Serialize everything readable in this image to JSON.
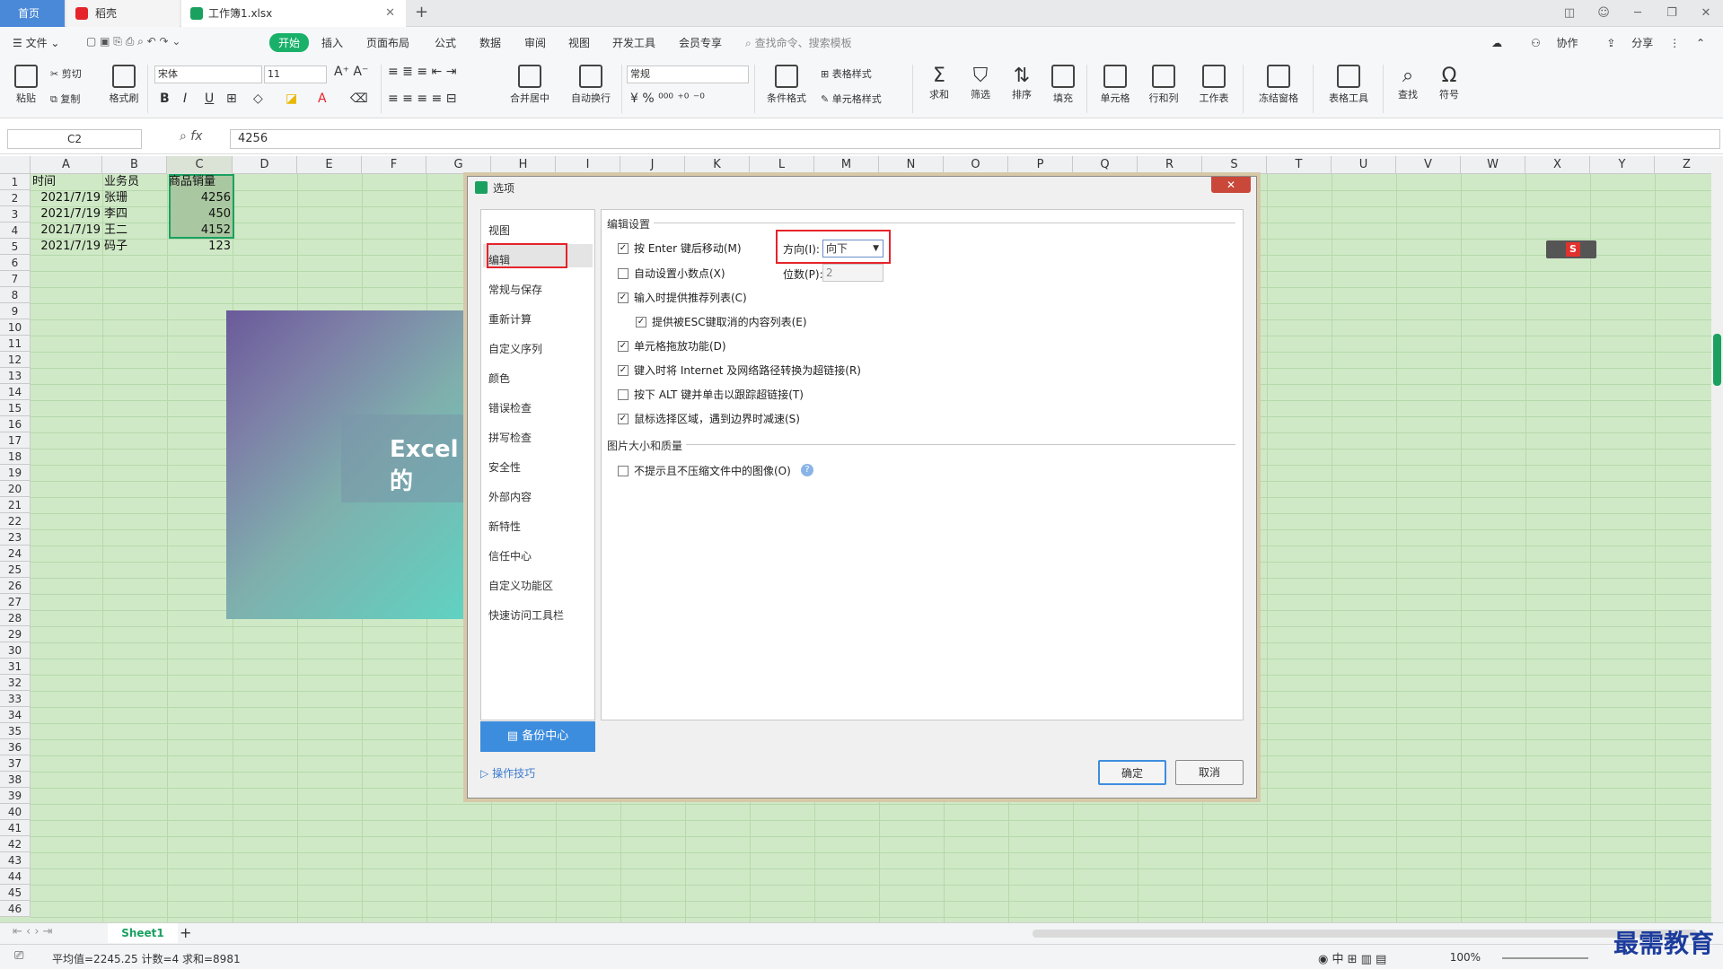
{
  "tabs": {
    "home": "首页",
    "docer": "稻壳",
    "workbook": "工作簿1.xlsx"
  },
  "menu": {
    "file": "文件",
    "start": "开始",
    "insert": "插入",
    "layout": "页面布局",
    "formula": "公式",
    "data": "数据",
    "review": "审阅",
    "view": "视图",
    "dev": "开发工具",
    "member": "会员专享",
    "search": "查找命令、搜索模板",
    "collab": "协作",
    "share": "分享"
  },
  "ribbon": {
    "paste": "粘贴",
    "cut": "剪切",
    "copy": "复制",
    "format_painter": "格式刷",
    "font": "宋体",
    "size": "11",
    "merge": "合并居中",
    "wrap": "自动换行",
    "num_format": "常规",
    "cond_format": "条件格式",
    "table_style": "表格样式",
    "cell_style": "单元格样式",
    "sum": "求和",
    "filter": "筛选",
    "sort": "排序",
    "fill": "填充",
    "cell": "单元格",
    "rowcol": "行和列",
    "sheet": "工作表",
    "freeze": "冻结窗格",
    "table_tools": "表格工具",
    "find": "查找",
    "symbol": "符号"
  },
  "formula": {
    "cell_ref": "C2",
    "fx": "fx",
    "value": "4256"
  },
  "columns": [
    "A",
    "B",
    "C",
    "D",
    "E",
    "F",
    "G",
    "H",
    "I",
    "J",
    "K",
    "L",
    "M",
    "N",
    "O",
    "P",
    "Q",
    "R",
    "S",
    "T",
    "U",
    "V",
    "W",
    "X",
    "Y",
    "Z"
  ],
  "rows": [
    "1",
    "2",
    "3",
    "4",
    "5",
    "6",
    "7",
    "8",
    "9",
    "10",
    "11",
    "12",
    "13",
    "14",
    "15",
    "16",
    "17",
    "18",
    "19",
    "20",
    "21",
    "22",
    "23",
    "24",
    "25",
    "26",
    "27",
    "28",
    "29",
    "30",
    "31",
    "32",
    "33",
    "34",
    "35",
    "36",
    "37",
    "38",
    "39",
    "40",
    "41",
    "42",
    "43",
    "44",
    "45",
    "46"
  ],
  "cells": {
    "header": [
      "时间",
      "业务员",
      "商品销量"
    ],
    "data": [
      [
        "2021/7/19",
        "张珊",
        "4256"
      ],
      [
        "2021/7/19",
        "李四",
        "450"
      ],
      [
        "2021/7/19",
        "王二",
        "4152"
      ],
      [
        "2021/7/19",
        "码子",
        "123"
      ]
    ]
  },
  "promo": {
    "text": "Excel的"
  },
  "dialog": {
    "title": "选项",
    "close": "✕",
    "nav": [
      "视图",
      "编辑",
      "常规与保存",
      "重新计算",
      "自定义序列",
      "颜色",
      "错误检查",
      "拼写检查",
      "安全性",
      "外部内容",
      "新特性",
      "信任中心",
      "自定义功能区",
      "快速访问工具栏"
    ],
    "backup": "备份中心",
    "tips": "操作技巧",
    "section_edit": "编辑设置",
    "opt_enter": "按 Enter 键后移动(M)",
    "direction_label": "方向(I):",
    "direction_value": "向下",
    "opt_decimal": "自动设置小数点(X)",
    "digits_label": "位数(P):",
    "digits_value": "2",
    "opt_autocomplete": "输入时提供推荐列表(C)",
    "opt_esc": "提供被ESC键取消的内容列表(E)",
    "opt_drag": "单元格拖放功能(D)",
    "opt_hyperlink": "键入时将 Internet 及网络路径转换为超链接(R)",
    "opt_alt": "按下 ALT 键并单击以跟踪超链接(T)",
    "opt_mouse": "鼠标选择区域，遇到边界时减速(S)",
    "section_image": "图片大小和质量",
    "opt_image": "不提示且不压缩文件中的图像(O)",
    "ok": "确定",
    "cancel": "取消"
  },
  "sheetbar": {
    "sheet1": "Sheet1"
  },
  "status": {
    "stats": "平均值=2245.25  计数=4  求和=8981",
    "zoom": "100%"
  },
  "watermark": "最需教育"
}
